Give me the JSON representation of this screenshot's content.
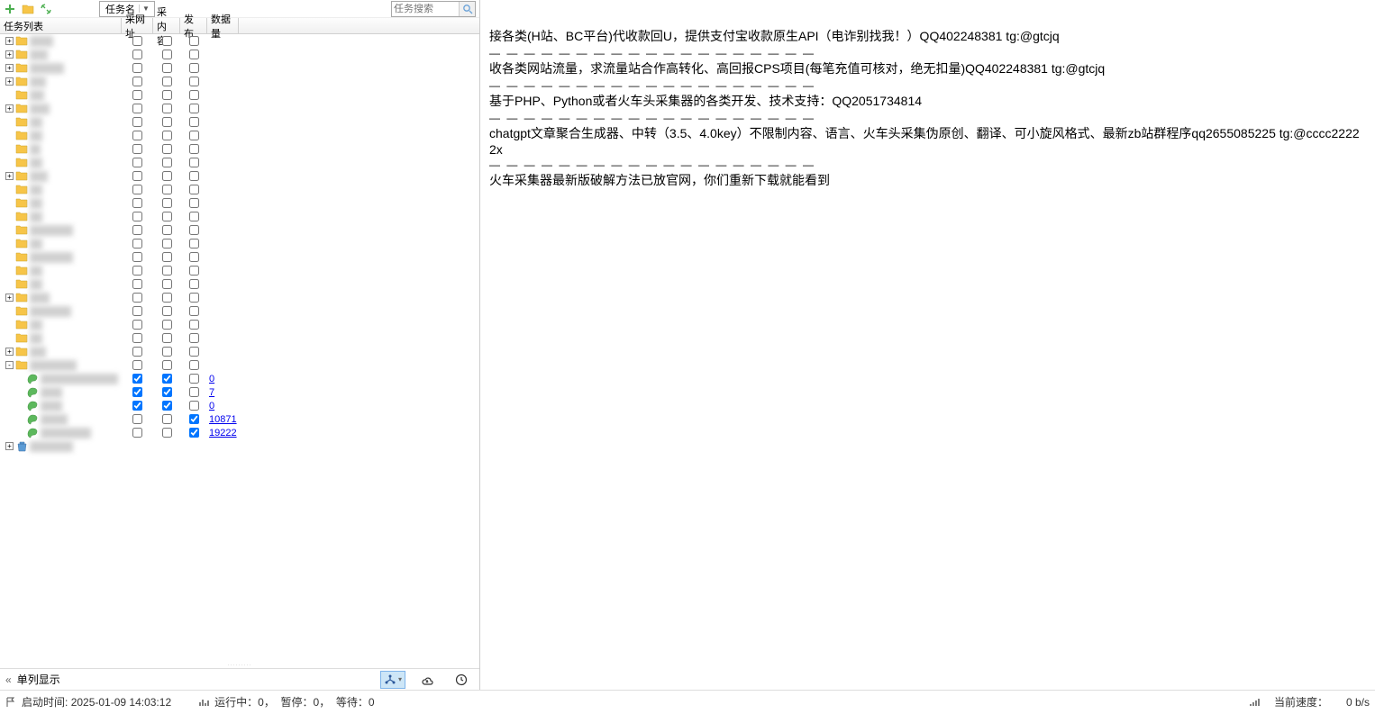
{
  "toolbar": {
    "dropdown_label": "任务名",
    "search_placeholder": "任务搜索"
  },
  "tree_header": {
    "col_name": "任务列表",
    "col_url": "采网址",
    "col_content": "采内容",
    "col_pub": "发布",
    "col_data": "数据量"
  },
  "tree_rows": [
    {
      "type": "folder",
      "indent": 1,
      "exp": "+",
      "blur_w": 26
    },
    {
      "type": "folder",
      "indent": 1,
      "exp": "+",
      "blur_w": 20
    },
    {
      "type": "folder",
      "indent": 1,
      "exp": "+",
      "blur_w": 38
    },
    {
      "type": "folder",
      "indent": 1,
      "exp": "+",
      "blur_w": 18
    },
    {
      "type": "folder",
      "indent": 1,
      "exp": "",
      "blur_w": 16
    },
    {
      "type": "folder",
      "indent": 1,
      "exp": "+",
      "blur_w": 22
    },
    {
      "type": "folder",
      "indent": 1,
      "exp": "",
      "blur_w": 14
    },
    {
      "type": "folder",
      "indent": 1,
      "exp": "",
      "blur_w": 14
    },
    {
      "type": "folder",
      "indent": 1,
      "exp": "",
      "blur_w": 12
    },
    {
      "type": "folder",
      "indent": 1,
      "exp": "",
      "blur_w": 14
    },
    {
      "type": "folder",
      "indent": 1,
      "exp": "+",
      "blur_w": 20
    },
    {
      "type": "folder",
      "indent": 1,
      "exp": "",
      "blur_w": 14
    },
    {
      "type": "folder",
      "indent": 1,
      "exp": "",
      "blur_w": 14
    },
    {
      "type": "folder",
      "indent": 1,
      "exp": "",
      "blur_w": 14
    },
    {
      "type": "folder",
      "indent": 1,
      "exp": "",
      "blur_w": 48
    },
    {
      "type": "folder",
      "indent": 1,
      "exp": "",
      "blur_w": 14
    },
    {
      "type": "folder",
      "indent": 1,
      "exp": "",
      "blur_w": 48
    },
    {
      "type": "folder",
      "indent": 1,
      "exp": "",
      "blur_w": 14
    },
    {
      "type": "folder",
      "indent": 1,
      "exp": "",
      "blur_w": 14
    },
    {
      "type": "folder",
      "indent": 1,
      "exp": "+",
      "blur_w": 22
    },
    {
      "type": "folder",
      "indent": 1,
      "exp": "",
      "blur_w": 46
    },
    {
      "type": "folder",
      "indent": 1,
      "exp": "",
      "blur_w": 14
    },
    {
      "type": "folder",
      "indent": 1,
      "exp": "",
      "blur_w": 14
    },
    {
      "type": "folder",
      "indent": 1,
      "exp": "+",
      "blur_w": 18
    },
    {
      "type": "folder",
      "indent": 1,
      "exp": "-",
      "blur_w": 52
    },
    {
      "type": "leaf",
      "indent": 2,
      "blur_w": 86,
      "cb": [
        true,
        true,
        false
      ],
      "value": "0"
    },
    {
      "type": "leaf",
      "indent": 2,
      "blur_w": 24,
      "cb": [
        true,
        true,
        false
      ],
      "value": "7"
    },
    {
      "type": "leaf",
      "indent": 2,
      "blur_w": 24,
      "cb": [
        true,
        true,
        false
      ],
      "value": "0"
    },
    {
      "type": "leaf",
      "indent": 2,
      "blur_w": 30,
      "cb": [
        false,
        false,
        true
      ],
      "value": "10871"
    },
    {
      "type": "leaf",
      "indent": 2,
      "blur_w": 56,
      "cb": [
        false,
        false,
        true
      ],
      "value": "19222"
    },
    {
      "type": "trash",
      "indent": 1,
      "exp": "+",
      "blur_w": 48
    }
  ],
  "bottom_bar": {
    "toggle_label": "单列显示"
  },
  "statusbar": {
    "startup_label": "启动时间:",
    "startup_time": "2025-01-09 14:03:12",
    "running_label": "运行中：",
    "running_val": "0，",
    "paused_label": "暂停：",
    "paused_val": "0，",
    "waiting_label": "等待：",
    "waiting_val": "0",
    "speed_label": "当前速度：",
    "speed_val": "0 b/s"
  },
  "ads": [
    "接各类(H站、BC平台)代收款回U，提供支付宝收款原生API（电诈别找我！）QQ402248381 tg:@gtcjq",
    "收各类网站流量，求流量站合作高转化、高回报CPS项目(每笔充值可核对，绝无扣量)QQ402248381 tg:@gtcjq",
    "基于PHP、Python或者火车头采集器的各类开发、技术支持：QQ2051734814",
    "chatgpt文章聚合生成器、中转（3.5、4.0key）不限制内容、语言、火车头采集伪原创、翻译、可小旋风格式、最新zb站群程序qq2655085225 tg:@cccc22222x",
    "火车采集器最新版破解方法已放官网，你们重新下载就能看到"
  ],
  "ad_sep": "— — — — — — — — — — — — — — — — — — —"
}
